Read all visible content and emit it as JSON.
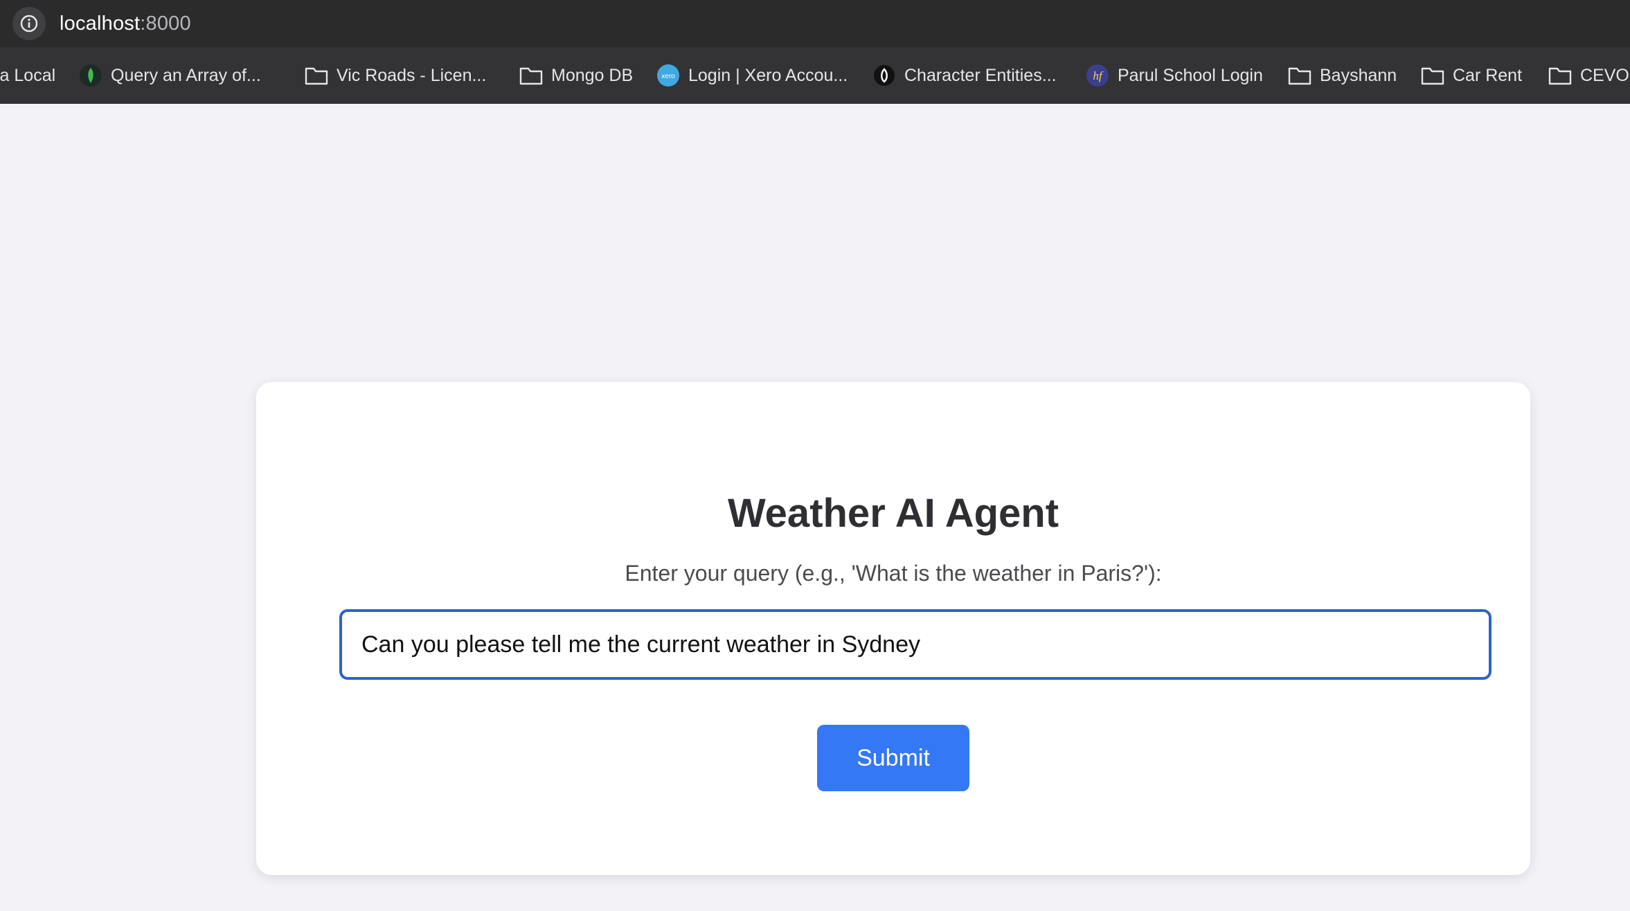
{
  "browser": {
    "url_host": "localhost",
    "url_port": ":8000",
    "bookmarks": [
      {
        "label": "la Local",
        "icon": "none"
      },
      {
        "label": "Query an Array of...",
        "icon": "mongodb-leaf-icon"
      },
      {
        "label": "Vic Roads - Licen...",
        "icon": "folder-icon"
      },
      {
        "label": "Mongo DB",
        "icon": "folder-icon"
      },
      {
        "label": "Login | Xero Accou...",
        "icon": "xero-icon"
      },
      {
        "label": "Character Entities...",
        "icon": "site-icon"
      },
      {
        "label": "Parul School Login",
        "icon": "hf-icon"
      },
      {
        "label": "Bayshann",
        "icon": "folder-icon"
      },
      {
        "label": "Car Rent",
        "icon": "folder-icon"
      },
      {
        "label": "CEVO",
        "icon": "folder-icon"
      }
    ]
  },
  "app": {
    "title": "Weather AI Agent",
    "prompt_label": "Enter your query (e.g., 'What is the weather in Paris?'):",
    "query_value": "Can you please tell me the current weather in Sydney",
    "submit_label": "Submit"
  },
  "colors": {
    "accent": "#3478f6",
    "input_focus_border": "#2d63c8",
    "page_background": "#f3f3f7"
  }
}
